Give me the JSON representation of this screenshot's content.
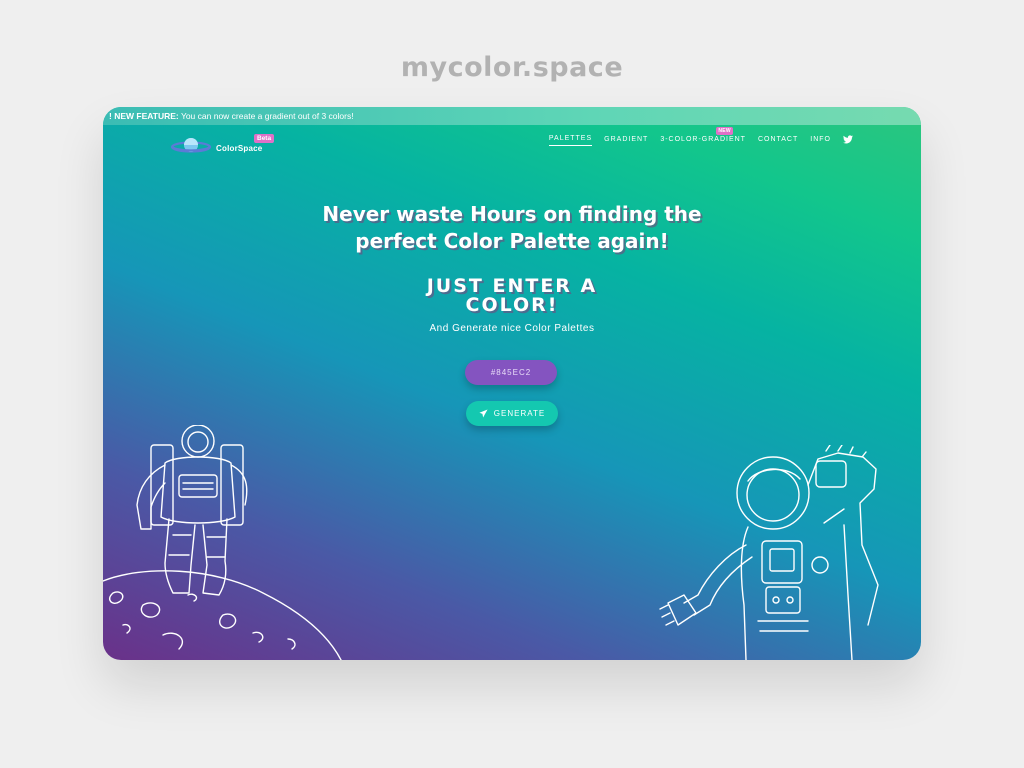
{
  "showcase": {
    "site_title": "mycolor.space"
  },
  "banner": {
    "prefix": "! ",
    "feature_label": "NEW FEATURE:",
    "message": " You can now create a gradient out of 3 colors!"
  },
  "header": {
    "brand": "ColorSpace",
    "beta_badge": "Beta",
    "nav": [
      {
        "label": "PALETTES",
        "active": true
      },
      {
        "label": "GRADIENT",
        "active": false
      },
      {
        "label": "3-COLOR-GRADIENT",
        "active": false,
        "badge": "NEW"
      },
      {
        "label": "CONTACT",
        "active": false
      },
      {
        "label": "INFO",
        "active": false
      }
    ],
    "social_icon": "twitter-icon"
  },
  "hero": {
    "headline_line1": "Never waste Hours on finding the",
    "headline_line2": "perfect Color Palette again!",
    "subhead_line1": "JUST ENTER A",
    "subhead_line2": "COLOR!",
    "tagline": "And Generate nice Color Palettes",
    "color_input_value": "#845EC2",
    "generate_label": "GENERATE",
    "generate_icon": "paper-plane-icon"
  },
  "colors": {
    "input_bg": "#845EC2",
    "button_bg": "#14C8B0",
    "badge": "#E070C8",
    "gradient_start": "#6A3189",
    "gradient_end": "#2CC67E"
  }
}
